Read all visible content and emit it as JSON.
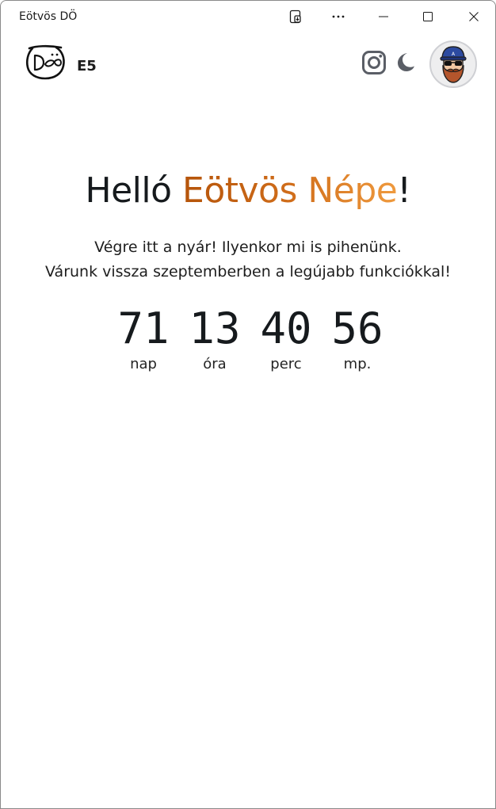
{
  "window": {
    "title": "Eötvös DÖ"
  },
  "header": {
    "brand_code": "E5",
    "icons": [
      "do-logo-icon",
      "instagram-icon",
      "moon-icon",
      "avatar"
    ]
  },
  "hero": {
    "greeting": "Helló",
    "highlight": "Eötvös Népe",
    "punct": "!",
    "accent_colors": [
      "#b5540a",
      "#ef9a3e"
    ]
  },
  "message": {
    "line1": "Végre itt a nyár! Ilyenkor mi is pihenünk.",
    "line2": "Várunk vissza szeptemberben a legújabb funkciókkal!"
  },
  "countdown": [
    {
      "value": "71",
      "label": "nap"
    },
    {
      "value": "13",
      "label": "óra"
    },
    {
      "value": "40",
      "label": "perc"
    },
    {
      "value": "56",
      "label": "mp."
    }
  ]
}
